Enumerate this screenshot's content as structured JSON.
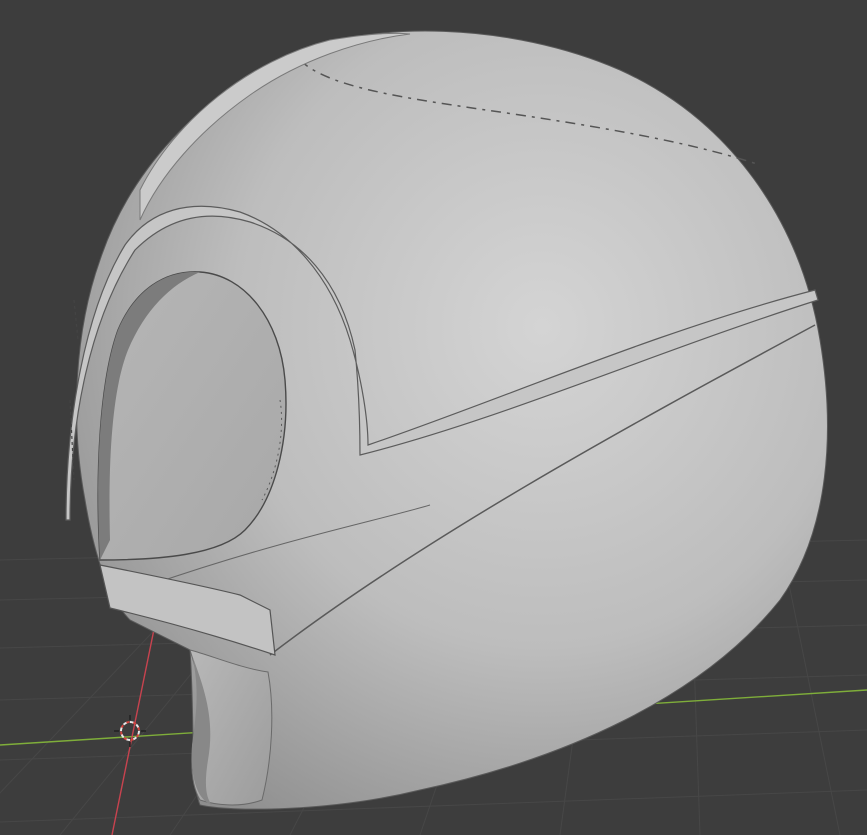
{
  "viewport": {
    "background": "#3d3d3d",
    "grid_color": "#4a4a4a",
    "x_axis_color": "#c8434f",
    "y_axis_color": "#7fae3a"
  },
  "object": {
    "name": "helmet-mesh",
    "shading": "solid",
    "base_color": "#b9b9b9",
    "highlight_color": "#d6d6d6",
    "shadow_color": "#6f6f6f"
  },
  "cursor": {
    "icon": "3d-cursor-icon"
  }
}
